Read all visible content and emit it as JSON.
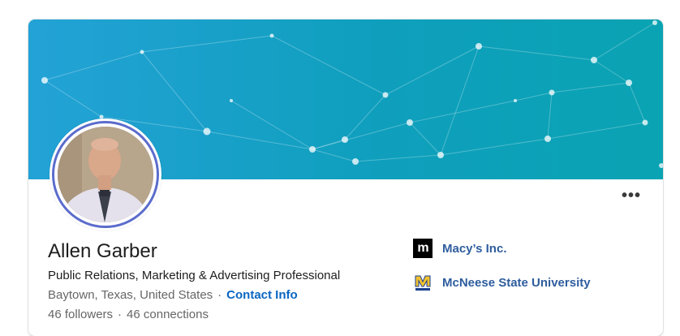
{
  "profile": {
    "name": "Allen Garber",
    "headline": "Public Relations, Marketing & Advertising Professional",
    "location": "Baytown, Texas, United States",
    "separator": "·",
    "contact_info_label": "Contact Info",
    "followers": "46 followers",
    "connections": "46 connections",
    "more_menu_label": "•••"
  },
  "experience": [
    {
      "label": "Macy’s Inc.",
      "logo_text": "m",
      "icon": "company-logo"
    },
    {
      "label": "McNeese State University",
      "logo_text": "M",
      "icon": "school-logo"
    }
  ],
  "colors": {
    "banner_start": "#23a2d6",
    "banner_end": "#0aa3b3",
    "link": "#0a66c2",
    "exp_link": "#2e5d9e",
    "ring": "#5b6ccc",
    "mcneese_gold": "#f2c12e",
    "mcneese_blue": "#1a3f8f"
  }
}
